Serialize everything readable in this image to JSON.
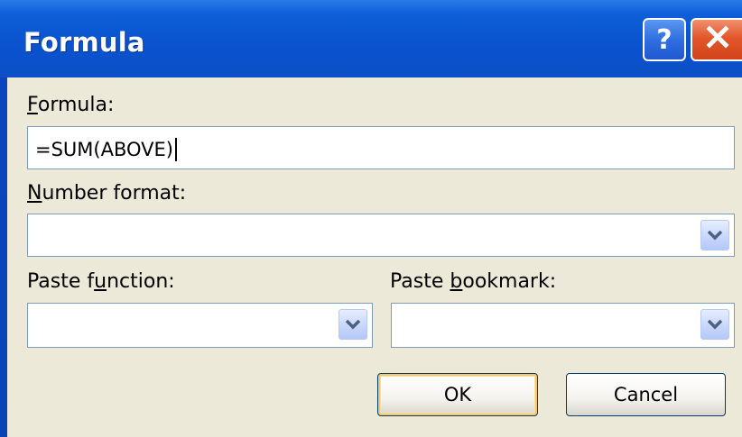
{
  "dialog": {
    "title": "Formula",
    "help_glyph": "?",
    "close_glyph": "✕",
    "icons": {
      "help": "help-icon",
      "close": "close-icon",
      "dropdown": "chevron-down-icon"
    }
  },
  "formula": {
    "label_accel": "F",
    "label_rest": "ormula:",
    "value": "=SUM(ABOVE)"
  },
  "number_format": {
    "label_accel": "N",
    "label_rest": "umber format:",
    "value": ""
  },
  "paste_function": {
    "label_pre": "Paste f",
    "label_accel": "u",
    "label_post": "nction:",
    "value": ""
  },
  "paste_bookmark": {
    "label_pre": "Paste ",
    "label_accel": "b",
    "label_post": "ookmark:",
    "value": ""
  },
  "buttons": {
    "ok_label": "OK",
    "cancel_label": "Cancel"
  },
  "colors": {
    "titlebar": "#0a53cf",
    "dialog_face": "#ece9d8",
    "close_button": "#e3562b",
    "field_border": "#7f9db9"
  }
}
